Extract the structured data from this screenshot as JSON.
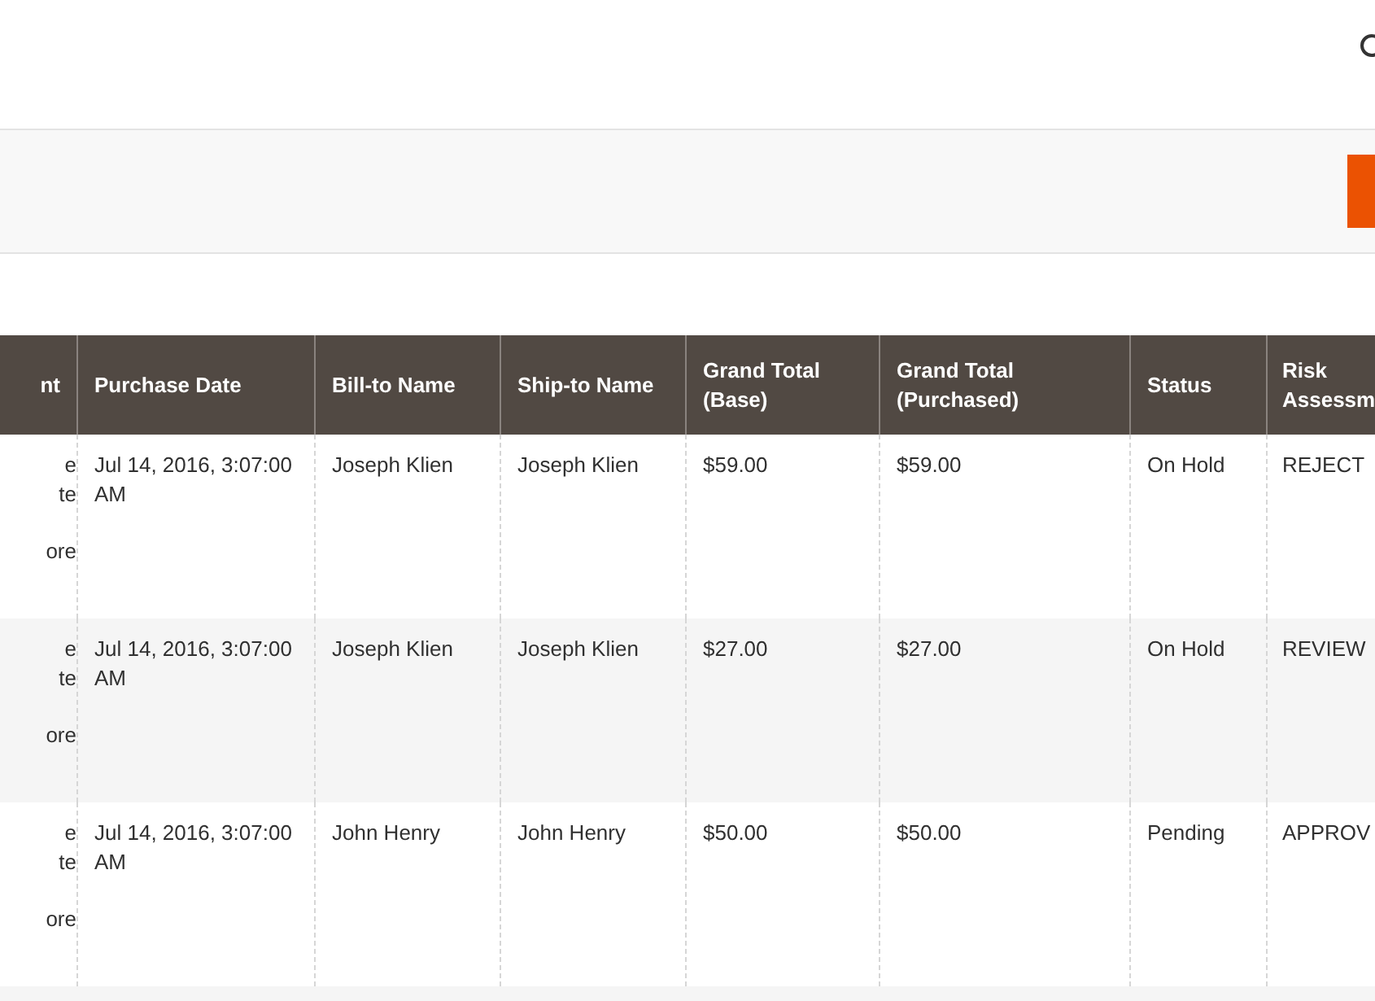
{
  "table": {
    "columns": [
      "nt",
      "Purchase Date",
      "Bill-to Name",
      "Ship-to Name",
      "Grand Total (Base)",
      "Grand Total (Purchased)",
      "Status",
      "Risk Assessm"
    ],
    "rows": [
      {
        "column_1": [
          "e",
          "te",
          "ore"
        ],
        "purchase_date": "Jul 14, 2016, 3:07:00 AM",
        "bill_to": "Joseph Klien",
        "ship_to": "Joseph Klien",
        "total_base": "$59.00",
        "total_purchased": "$59.00",
        "status": "On Hold",
        "risk": "REJECT"
      },
      {
        "column_1": [
          "e",
          "te",
          "ore"
        ],
        "purchase_date": "Jul 14, 2016, 3:07:00 AM",
        "bill_to": "Joseph Klien",
        "ship_to": "Joseph Klien",
        "total_base": "$27.00",
        "total_purchased": "$27.00",
        "status": "On Hold",
        "risk": "REVIEW"
      },
      {
        "column_1": [
          "e",
          "te",
          "ore"
        ],
        "purchase_date": "Jul 14, 2016, 3:07:00 AM",
        "bill_to": "John Henry",
        "ship_to": "John Henry",
        "total_base": "$50.00",
        "total_purchased": "$50.00",
        "status": "Pending",
        "risk": "APPROV"
      }
    ]
  }
}
